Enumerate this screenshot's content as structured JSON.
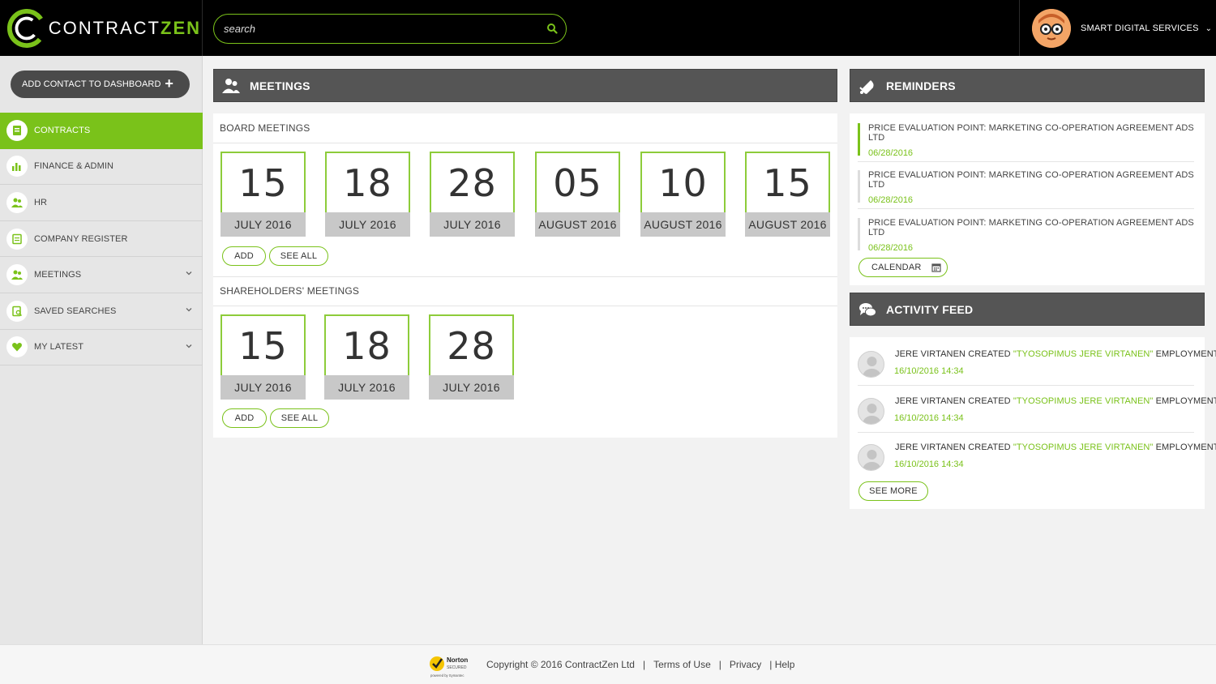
{
  "header": {
    "logo_text": "CONTRACT",
    "logo_text_accent": "ZEN",
    "search_placeholder": "search",
    "user_name": "SMART DIGITAL SERVICES",
    "user_caret": "⌄"
  },
  "sidebar": {
    "add_contact_label": "ADD CONTACT TO DASHBOARD",
    "add_contact_plus": "+",
    "items": [
      {
        "label": "CONTRACTS",
        "icon": "contracts-icon",
        "active": true,
        "caret": false
      },
      {
        "label": "FINANCE & ADMIN",
        "icon": "bar-chart-icon",
        "active": false,
        "caret": false
      },
      {
        "label": "HR",
        "icon": "people-icon",
        "active": false,
        "caret": false
      },
      {
        "label": "COMPANY REGISTER",
        "icon": "register-icon",
        "active": false,
        "caret": false
      },
      {
        "label": "MEETINGS",
        "icon": "meetings-icon",
        "active": false,
        "caret": true
      },
      {
        "label": "SAVED SEARCHES",
        "icon": "saved-search-icon",
        "active": false,
        "caret": true
      },
      {
        "label": "MY LATEST",
        "icon": "heart-icon",
        "active": false,
        "caret": true
      }
    ]
  },
  "meetings": {
    "title": "MEETINGS",
    "board": {
      "title": "BOARD MEETINGS",
      "dates": [
        {
          "day": "15",
          "month": "JULY 2016"
        },
        {
          "day": "18",
          "month": "JULY 2016"
        },
        {
          "day": "28",
          "month": "JULY 2016"
        },
        {
          "day": "05",
          "month": "AUGUST 2016"
        },
        {
          "day": "10",
          "month": "AUGUST 2016"
        },
        {
          "day": "15",
          "month": "AUGUST 2016"
        }
      ],
      "add_label": "ADD",
      "see_all_label": "SEE ALL"
    },
    "shareholders": {
      "title": "SHAREHOLDERS' MEETINGS",
      "dates": [
        {
          "day": "15",
          "month": "JULY 2016"
        },
        {
          "day": "18",
          "month": "JULY 2016"
        },
        {
          "day": "28",
          "month": "JULY 2016"
        }
      ],
      "add_label": "ADD",
      "see_all_label": "SEE ALL"
    }
  },
  "reminders": {
    "title": "REMINDERS",
    "items": [
      {
        "title": "PRICE EVALUATION POINT: MARKETING CO-OPERATION AGREEMENT ADS LTD",
        "date": "06/28/2016"
      },
      {
        "title": "PRICE EVALUATION POINT: MARKETING CO-OPERATION AGREEMENT ADS LTD",
        "date": "06/28/2016"
      },
      {
        "title": "PRICE EVALUATION POINT: MARKETING CO-OPERATION AGREEMENT ADS LTD",
        "date": "06/28/2016"
      }
    ],
    "calendar_label": "CALENDAR"
  },
  "activity": {
    "title": "ACTIVITY FEED",
    "items": [
      {
        "prefix": "JERE VIRTANEN CREATED ",
        "highlight": "\"TYOSOPIMUS JERE VIRTANEN\"",
        "suffix": " EMPLOYMENT",
        "date": "16/10/2016  14:34"
      },
      {
        "prefix": "JERE VIRTANEN CREATED ",
        "highlight": "\"TYOSOPIMUS JERE VIRTANEN\"",
        "suffix": " EMPLOYMENT",
        "date": "16/10/2016  14:34"
      },
      {
        "prefix": "JERE VIRTANEN CREATED ",
        "highlight": "\"TYOSOPIMUS JERE VIRTANEN\"",
        "suffix": " EMPLOYMENT",
        "date": "16/10/2016  14:34"
      }
    ],
    "see_more_label": "SEE MORE"
  },
  "footer": {
    "norton_text": "Norton",
    "norton_sub": "SECURED",
    "norton_powered": "powered by Symantec",
    "copyright": "Copyright © 2016 ContractZen Ltd",
    "sep1": "   |   ",
    "terms": "Terms of Use",
    "sep2": "   |   ",
    "privacy": "Privacy",
    "sep3": "   | ",
    "help": "Help"
  },
  "colors": {
    "accent": "#7ac21a",
    "header_bg": "#000000",
    "panel_head": "#555555"
  }
}
